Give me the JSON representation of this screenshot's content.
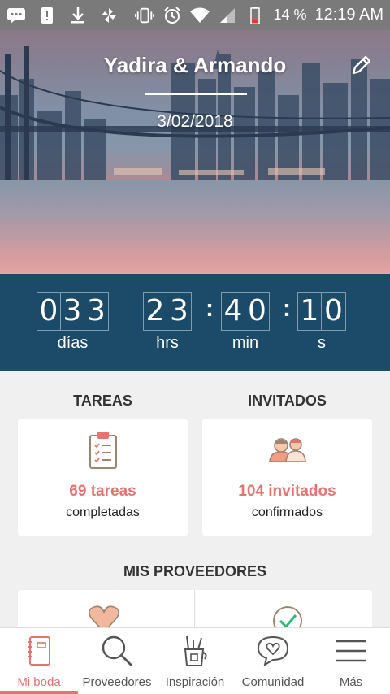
{
  "status_bar": {
    "battery": "14 %",
    "time": "12:19 AM",
    "icons": [
      "message-icon",
      "alert-icon",
      "download-icon",
      "pinwheel-icon",
      "vibrate-icon",
      "alarm-icon",
      "wifi-icon",
      "signal-icon",
      "battery-icon"
    ]
  },
  "hero": {
    "title": "Yadira & Armando",
    "date": "3/02/2018"
  },
  "countdown": {
    "days_digits": [
      "0",
      "3",
      "3"
    ],
    "hours_digits": [
      "2",
      "3"
    ],
    "minutes_digits": [
      "4",
      "0"
    ],
    "seconds_digits": [
      "1",
      "0"
    ],
    "separator": ":",
    "labels": {
      "days": "días",
      "hours": "hrs",
      "minutes": "min",
      "seconds": "s"
    }
  },
  "tasks": {
    "title": "TAREAS",
    "value": "69 tareas",
    "sub": "completadas"
  },
  "guests": {
    "title": "INVITADOS",
    "value": "104 invitados",
    "sub": "confirmados"
  },
  "providers": {
    "title": "MIS PROVEEDORES"
  },
  "nav": {
    "items": [
      {
        "label": "Mi boda",
        "icon": "notebook-icon"
      },
      {
        "label": "Proveedores",
        "icon": "search-icon"
      },
      {
        "label": "Inspiración",
        "icon": "pencil-cup-icon"
      },
      {
        "label": "Comunidad",
        "icon": "chat-heart-icon"
      },
      {
        "label": "Más",
        "icon": "menu-icon"
      }
    ]
  },
  "colors": {
    "accent": "#e5736f",
    "countdown_bg": "#1c4b6a",
    "status_bar_bg": "#7a7a7a"
  }
}
